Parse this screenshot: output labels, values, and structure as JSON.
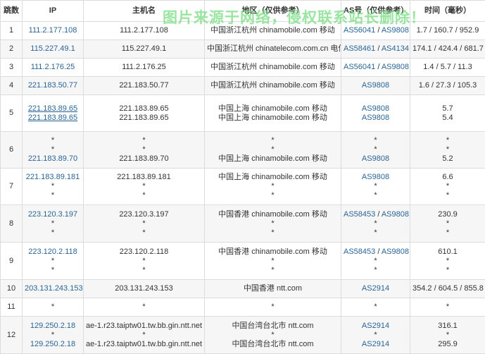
{
  "watermark": "图片来源于网络，侵权联系站长删除！",
  "headers": [
    "跳数",
    "IP",
    "主机名",
    "地区（仅供参考）",
    "AS号（仅供参考）",
    "时间（毫秒）"
  ],
  "rows": [
    {
      "hop": "1",
      "ips": [
        {
          "t": "111.2.177.108",
          "link": true
        }
      ],
      "hosts": [
        "111.2.177.108"
      ],
      "regions": [
        "中国浙江杭州 chinamobile.com 移动"
      ],
      "as": [
        [
          "AS56041",
          "AS9808"
        ]
      ],
      "times": [
        "1.7 / 160.7 / 952.9"
      ]
    },
    {
      "hop": "2",
      "ips": [
        {
          "t": "115.227.49.1",
          "link": true
        }
      ],
      "hosts": [
        "115.227.49.1"
      ],
      "regions": [
        "中国浙江杭州 chinatelecom.com.cn 电信"
      ],
      "as": [
        [
          "AS58461",
          "AS4134"
        ]
      ],
      "times": [
        "174.1 / 424.4 / 681.7"
      ]
    },
    {
      "hop": "3",
      "ips": [
        {
          "t": "111.2.176.25",
          "link": true
        }
      ],
      "hosts": [
        "111.2.176.25"
      ],
      "regions": [
        "中国浙江杭州 chinamobile.com 移动"
      ],
      "as": [
        [
          "AS56041",
          "AS9808"
        ]
      ],
      "times": [
        "1.4 / 5.7 / 11.3"
      ]
    },
    {
      "hop": "4",
      "ips": [
        {
          "t": "221.183.50.77",
          "link": true
        }
      ],
      "hosts": [
        "221.183.50.77"
      ],
      "regions": [
        "中国浙江杭州 chinamobile.com 移动"
      ],
      "as": [
        [
          "AS9808"
        ]
      ],
      "times": [
        "1.6 / 27.3 / 105.3"
      ]
    },
    {
      "hop": "5",
      "ips": [
        {
          "t": "221.183.89.65",
          "link": true,
          "ul": true
        },
        {
          "t": "221.183.89.65",
          "link": true,
          "ul": true
        }
      ],
      "hosts": [
        "221.183.89.65",
        "221.183.89.65"
      ],
      "regions": [
        "中国上海 chinamobile.com 移动",
        "中国上海 chinamobile.com 移动"
      ],
      "as": [
        [
          "AS9808"
        ],
        [
          "AS9808"
        ]
      ],
      "times": [
        "5.7",
        "5.4"
      ],
      "h": 51
    },
    {
      "hop": "6",
      "ips": [
        {
          "t": "*"
        },
        {
          "t": "*"
        },
        {
          "t": "221.183.89.70",
          "link": true
        }
      ],
      "hosts": [
        "*",
        "*",
        "221.183.89.70"
      ],
      "regions": [
        "*",
        "*",
        "中国上海 chinamobile.com 移动"
      ],
      "as": [
        [
          "*"
        ],
        [
          "*"
        ],
        [
          "AS9808"
        ]
      ],
      "times": [
        "*",
        "*",
        "5.2"
      ],
      "h": 51
    },
    {
      "hop": "7",
      "ips": [
        {
          "t": "221.183.89.181",
          "link": true
        },
        {
          "t": "*"
        },
        {
          "t": "*"
        }
      ],
      "hosts": [
        "221.183.89.181",
        "*",
        "*"
      ],
      "regions": [
        "中国上海 chinamobile.com 移动",
        "*",
        "*"
      ],
      "as": [
        [
          "AS9808"
        ],
        [
          "*"
        ],
        [
          "*"
        ]
      ],
      "times": [
        "6.6",
        "*",
        "*"
      ],
      "h": 51
    },
    {
      "hop": "8",
      "ips": [
        {
          "t": "223.120.3.197",
          "link": true
        },
        {
          "t": "*"
        },
        {
          "t": "*"
        }
      ],
      "hosts": [
        "223.120.3.197",
        "*",
        "*"
      ],
      "regions": [
        "中国香港 chinamobile.com 移动",
        "*",
        "*"
      ],
      "as": [
        [
          "AS58453",
          "AS9808"
        ],
        [
          "*"
        ],
        [
          "*"
        ]
      ],
      "times": [
        "230.9",
        "*",
        "*"
      ],
      "h": 52
    },
    {
      "hop": "9",
      "ips": [
        {
          "t": "223.120.2.118",
          "link": true
        },
        {
          "t": "*"
        },
        {
          "t": "*"
        }
      ],
      "hosts": [
        "223.120.2.118",
        "*",
        "*"
      ],
      "regions": [
        "中国香港 chinamobile.com 移动",
        "*",
        "*"
      ],
      "as": [
        [
          "AS58453",
          "AS9808"
        ],
        [
          "*"
        ],
        [
          "*"
        ]
      ],
      "times": [
        "610.1",
        "*",
        "*"
      ],
      "h": 52
    },
    {
      "hop": "10",
      "ips": [
        {
          "t": "203.131.243.153",
          "link": true
        }
      ],
      "hosts": [
        "203.131.243.153"
      ],
      "regions": [
        "中国香港 ntt.com"
      ],
      "as": [
        [
          "AS2914"
        ]
      ],
      "times": [
        "354.2 / 604.5 / 855.8"
      ]
    },
    {
      "hop": "11",
      "ips": [
        {
          "t": "*"
        }
      ],
      "hosts": [
        "*"
      ],
      "regions": [
        "*"
      ],
      "as": [
        [
          "*"
        ]
      ],
      "times": [
        "*"
      ]
    },
    {
      "hop": "12",
      "ips": [
        {
          "t": "129.250.2.18",
          "link": true
        },
        {
          "t": "*"
        },
        {
          "t": "129.250.2.18",
          "link": true
        }
      ],
      "hosts": [
        "ae-1.r23.taiptw01.tw.bb.gin.ntt.net",
        "*",
        "ae-1.r23.taiptw01.tw.bb.gin.ntt.net"
      ],
      "regions": [
        "中国台湾台北市 ntt.com",
        "*",
        "中国台湾台北市 ntt.com"
      ],
      "as": [
        [
          "AS2914"
        ],
        [
          "*"
        ],
        [
          "AS2914"
        ]
      ],
      "times": [
        "316.1",
        "*",
        "295.9"
      ],
      "h": 52
    }
  ]
}
